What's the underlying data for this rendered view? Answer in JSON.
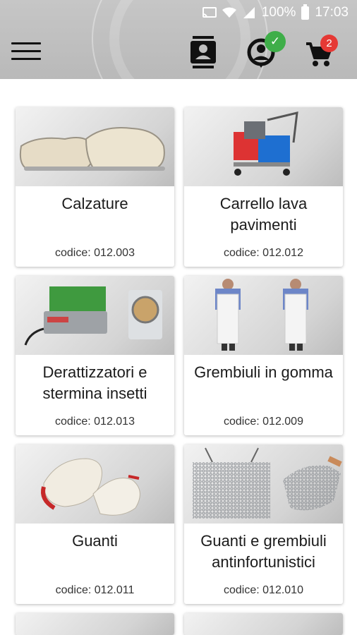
{
  "status_bar": {
    "battery": "100%",
    "time": "17:03",
    "icons": [
      "cast-icon",
      "wifi-icon",
      "signal-icon",
      "battery-icon"
    ]
  },
  "app_bar": {
    "menu_icon": "hamburger-menu-icon",
    "contacts_icon": "contact-card-icon",
    "account_icon": "user-account-icon",
    "account_status": "check-icon",
    "cart_icon": "shopping-cart-icon",
    "cart_count": "2",
    "colors": {
      "check_badge": "#3fae49",
      "cart_badge": "#e53935"
    }
  },
  "products": [
    {
      "title": "Calzature",
      "code": "codice: 012.003",
      "image": "white-shoes-photo"
    },
    {
      "title": "Carrello lava pavimenti",
      "code": "codice: 012.012",
      "image": "mop-cart-photo"
    },
    {
      "title": "Derattizzatori e stermina insetti",
      "code": "codice: 012.013",
      "image": "pest-control-devices-photo"
    },
    {
      "title": "Grembiuli in gomma",
      "code": "codice: 012.009",
      "image": "rubber-aprons-photo"
    },
    {
      "title": "Guanti",
      "code": "codice: 012.011",
      "image": "work-gloves-photo"
    },
    {
      "title": "Guanti e grembiuli antinfortunistici",
      "code": "codice: 012.010",
      "image": "chainmail-apron-gloves-photo"
    }
  ]
}
